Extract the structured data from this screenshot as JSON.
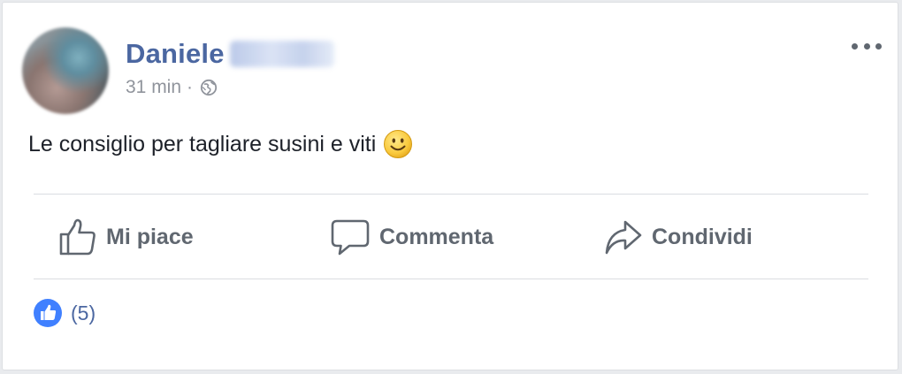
{
  "post": {
    "author_first_name": "Daniele",
    "timestamp": "31 min",
    "separator": "·",
    "privacy_icon": "globe-icon",
    "text": "Le consiglio per tagliare susini e viti",
    "emoji": "smile-emoji-icon"
  },
  "actions": {
    "like_label": "Mi piace",
    "comment_label": "Commenta",
    "share_label": "Condividi"
  },
  "reactions": {
    "count_text": "(5)",
    "icon": "like-badge-icon"
  },
  "colors": {
    "name": "#4b67a1",
    "meta": "#90949c",
    "action": "#606770",
    "like_blue": "#4080ff"
  }
}
